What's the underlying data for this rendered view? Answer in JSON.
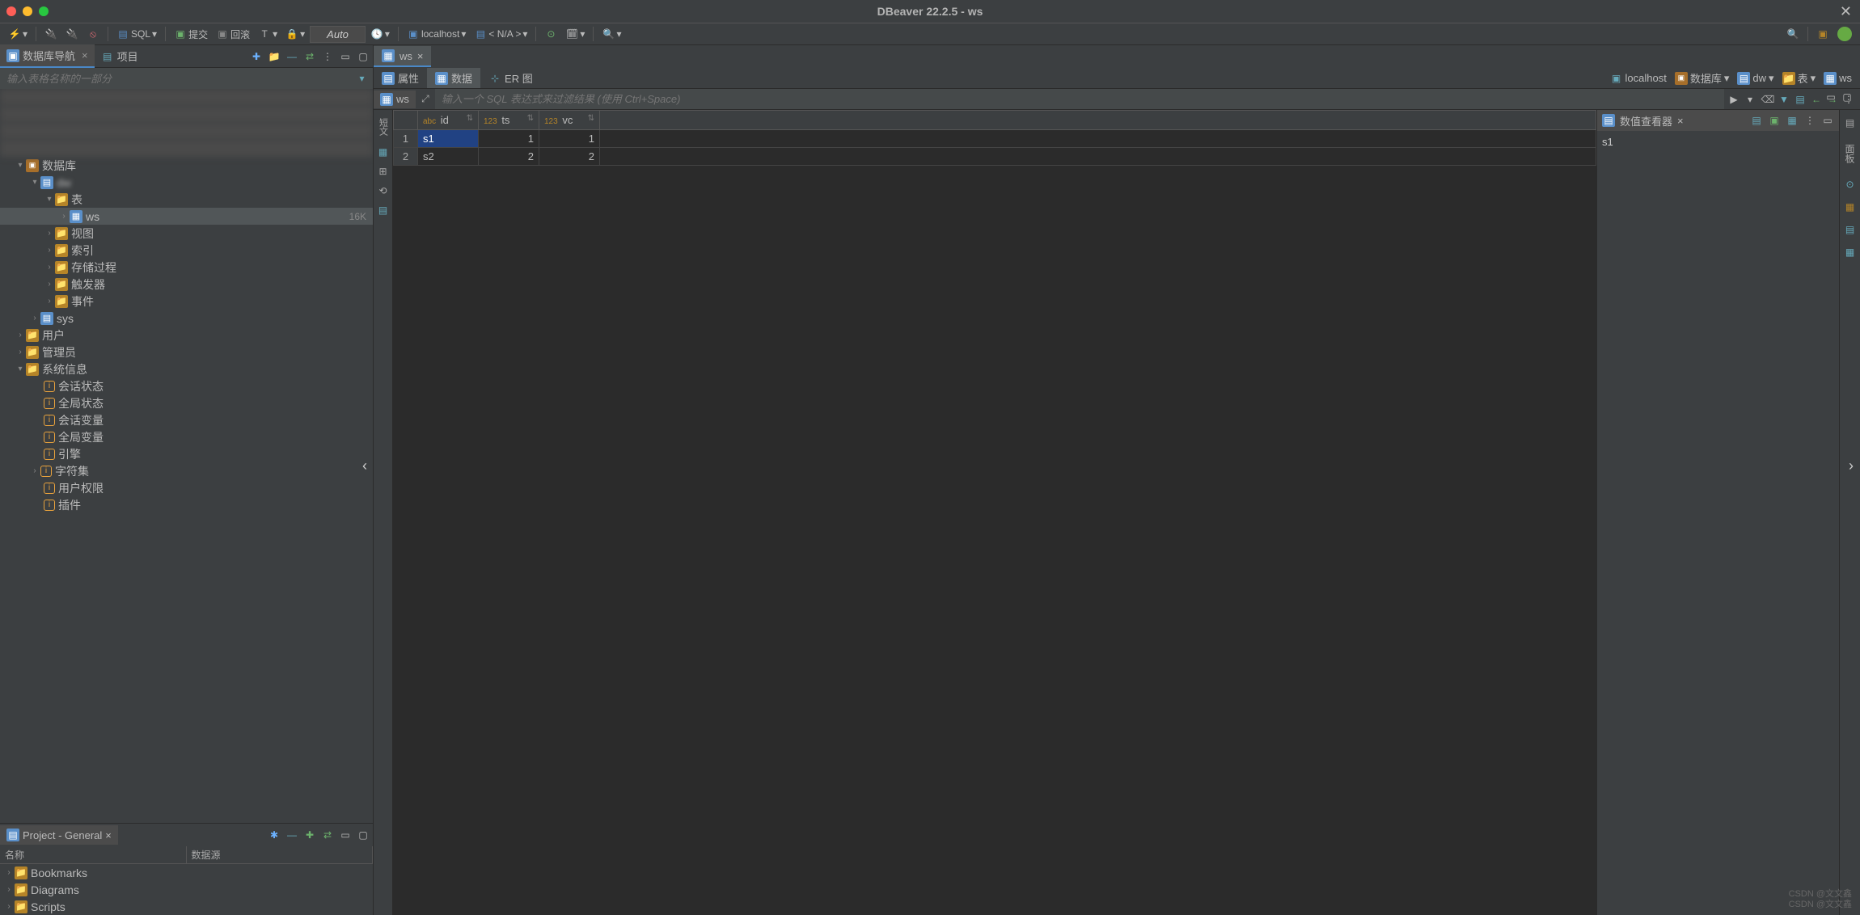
{
  "window": {
    "title": "DBeaver 22.2.5 - ws"
  },
  "toolbar": {
    "sql_label": "SQL",
    "commit_label": "提交",
    "rollback_label": "回滚",
    "auto_label": "Auto",
    "connection": "localhost",
    "schema": "< N/A >"
  },
  "nav": {
    "tab_db_navigator": "数据库导航",
    "tab_project": "项目",
    "filter_placeholder": "输入表格名称的一部分",
    "tree": {
      "databases": "数据库",
      "tables": "表",
      "ws": "ws",
      "ws_size": "16K",
      "views": "视图",
      "indexes": "索引",
      "procedures": "存储过程",
      "triggers": "触发器",
      "events": "事件",
      "sys": "sys",
      "users": "用户",
      "admin": "管理员",
      "sysinfo": "系统信息",
      "session_status": "会话状态",
      "global_status": "全局状态",
      "session_vars": "会话变量",
      "global_vars": "全局变量",
      "engines": "引擎",
      "charsets": "字符集",
      "user_privs": "用户权限",
      "plugins": "插件"
    }
  },
  "project": {
    "tab": "Project - General",
    "col_name": "名称",
    "col_datasource": "数据源",
    "items": {
      "bookmarks": "Bookmarks",
      "diagrams": "Diagrams",
      "scripts": "Scripts"
    }
  },
  "editor": {
    "tab_ws": "ws",
    "sub_props": "属性",
    "sub_data": "数据",
    "sub_er": "ER 图",
    "breadcrumb": {
      "conn": "localhost",
      "db": "数据库",
      "dw": "dw",
      "tables": "表",
      "ws": "ws"
    },
    "sql_ws": "ws",
    "sql_placeholder": "输入一个 SQL 表达式来过滤结果 (使用 Ctrl+Space)",
    "columns": [
      {
        "name": "id",
        "type": "abc"
      },
      {
        "name": "ts",
        "type": "123"
      },
      {
        "name": "vc",
        "type": "123"
      }
    ],
    "rows": [
      {
        "n": "1",
        "id": "s1",
        "ts": "1",
        "vc": "1"
      },
      {
        "n": "2",
        "id": "s2",
        "ts": "2",
        "vc": "2"
      }
    ]
  },
  "value_panel": {
    "title": "数值查看器",
    "value": "s1"
  },
  "watermark": {
    "line1": "CSDN @文文鑫",
    "line2": "CSDN @文文鑫"
  }
}
